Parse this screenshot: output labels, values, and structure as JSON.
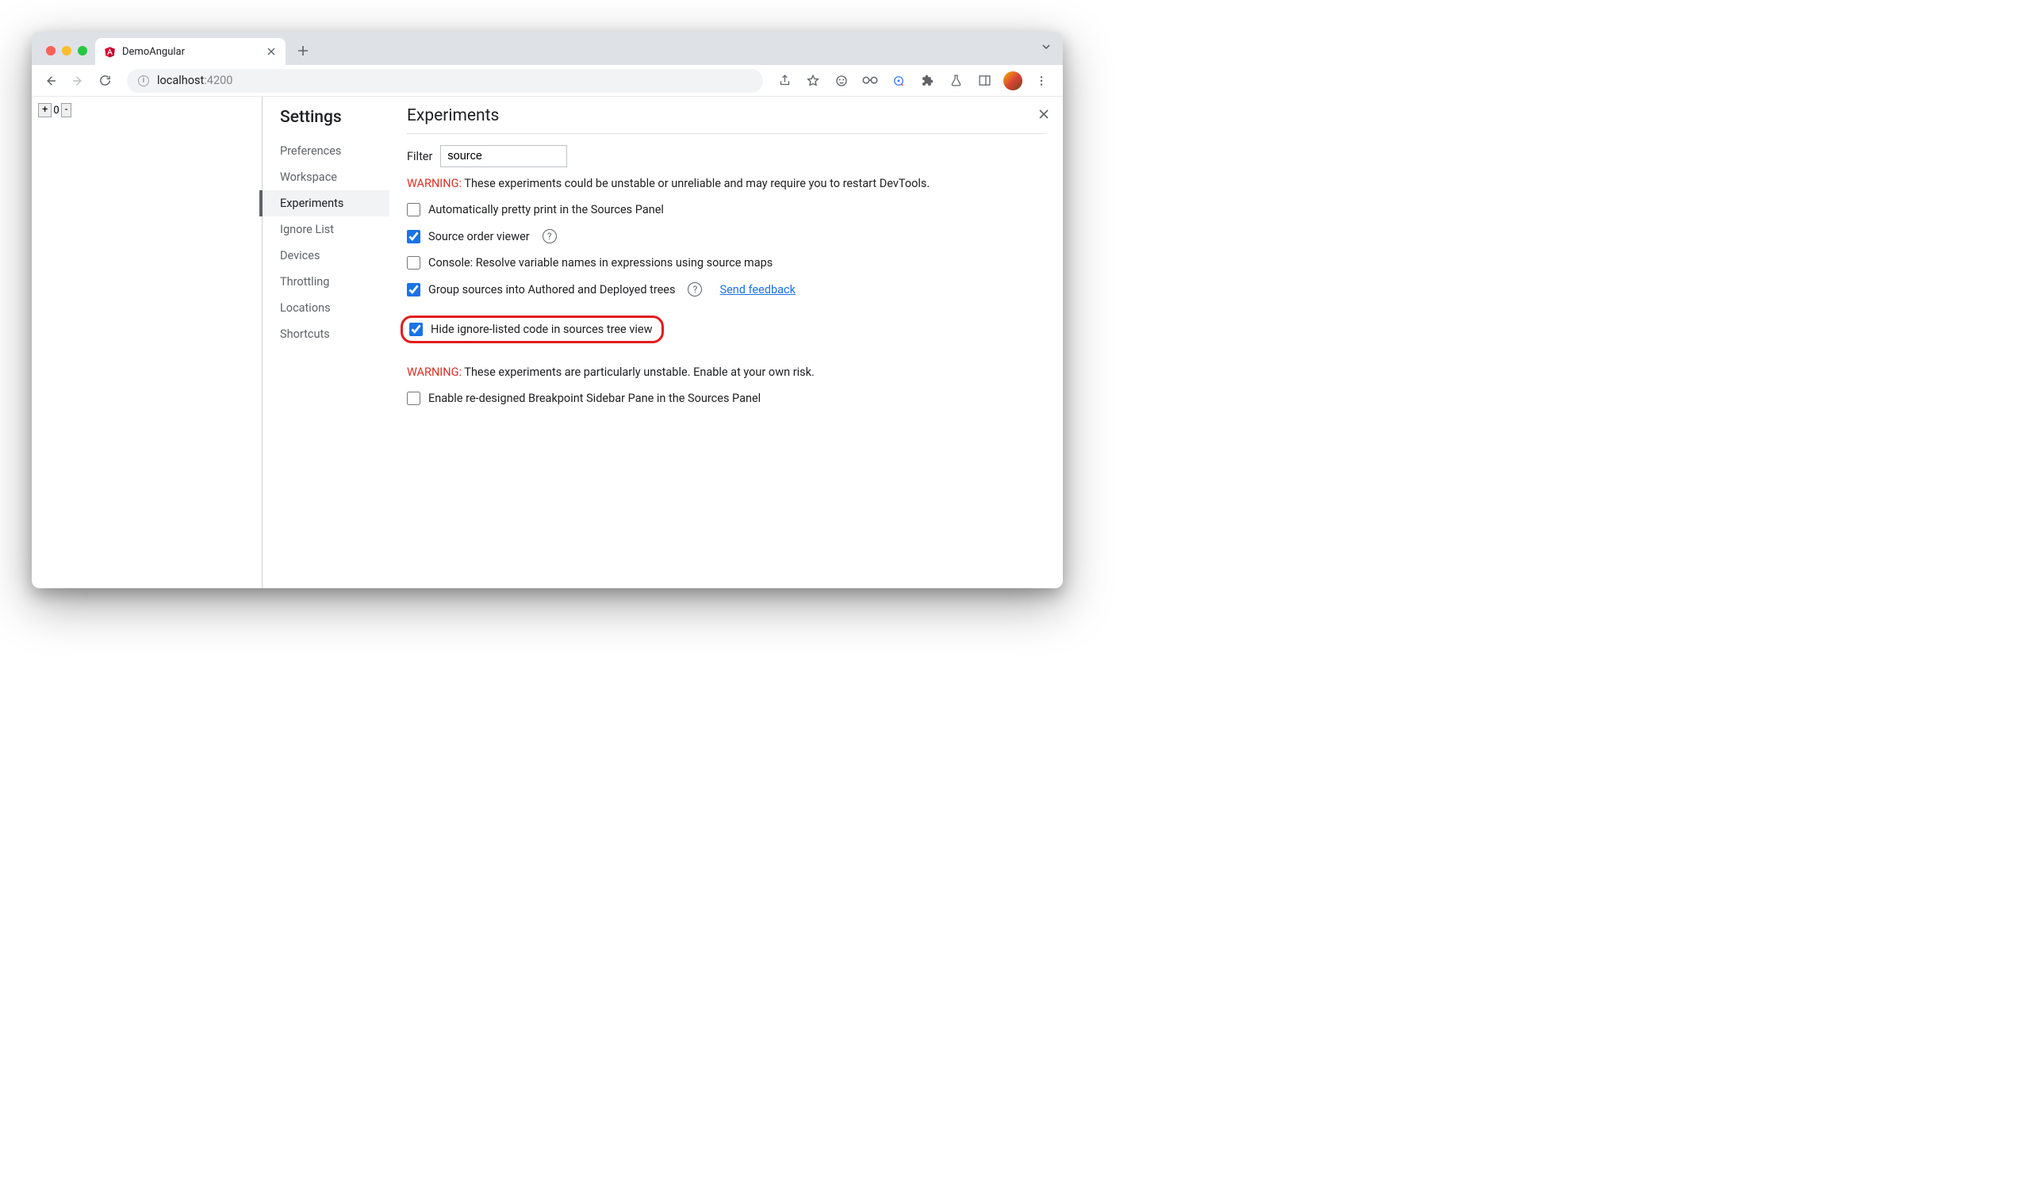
{
  "tab": {
    "title": "DemoAngular"
  },
  "omnibox": {
    "host": "localhost",
    "port": ":4200"
  },
  "page_counter": {
    "plus": "+",
    "value": "0",
    "minus": "-"
  },
  "settings": {
    "sidebar_title": "Settings",
    "items": [
      "Preferences",
      "Workspace",
      "Experiments",
      "Ignore List",
      "Devices",
      "Throttling",
      "Locations",
      "Shortcuts"
    ],
    "active_index": 2
  },
  "content": {
    "heading": "Experiments",
    "filter_label": "Filter",
    "filter_value": "source",
    "warning1_prefix": "WARNING:",
    "warning1_text": " These experiments could be unstable or unreliable and may require you to restart DevTools.",
    "experiments": [
      {
        "label": "Automatically pretty print in the Sources Panel",
        "checked": false,
        "help": false,
        "link": null,
        "highlight": false
      },
      {
        "label": "Source order viewer",
        "checked": true,
        "help": true,
        "link": null,
        "highlight": false
      },
      {
        "label": "Console: Resolve variable names in expressions using source maps",
        "checked": false,
        "help": false,
        "link": null,
        "highlight": false
      },
      {
        "label": "Group sources into Authored and Deployed trees",
        "checked": true,
        "help": true,
        "link": "Send feedback",
        "highlight": false
      },
      {
        "label": "Hide ignore-listed code in sources tree view",
        "checked": true,
        "help": false,
        "link": null,
        "highlight": true
      }
    ],
    "warning2_prefix": "WARNING:",
    "warning2_text": " These experiments are particularly unstable. Enable at your own risk.",
    "unstable_experiments": [
      {
        "label": "Enable re-designed Breakpoint Sidebar Pane in the Sources Panel",
        "checked": false
      }
    ]
  }
}
